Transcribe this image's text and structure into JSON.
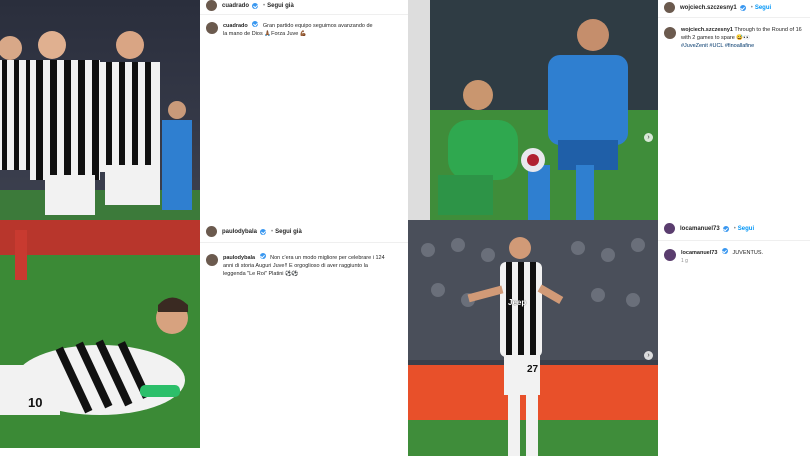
{
  "posts": [
    {
      "username": "cuadrado",
      "follow_label": "Segui già",
      "caption_user": "cuadrado",
      "caption": "Gran partido equipo seguimos avanzando de la mano de Dios 🙏🏾Forza Juve 💪🏾",
      "time": ""
    },
    {
      "username": "wojciech.szczesny1",
      "follow_label": "Segui",
      "caption_user": "wojciech.szczesny1",
      "caption": "Through to the Round of 16 with 2 games to spare 😅👀",
      "tags": "#JuveZenit #UCL #finoallafine",
      "time": ""
    },
    {
      "username": "paulodybala",
      "follow_label": "Segui già",
      "caption_user": "paulodybala",
      "caption": "Non c'era un modo migliore per celebrare i 124 anni di storia Auguri Juve!! E orgoglioso di aver raggiunto la leggenda \"Le Roi\" Platini ⚽⚽",
      "time": ""
    },
    {
      "username": "locamanuel73",
      "follow_label": "Segui",
      "caption_user": "locamanuel73",
      "caption": "JUVENTUS.",
      "time": "1 g"
    }
  ],
  "jerseys": {
    "number_10": "10",
    "number_27": "27",
    "sponsor": "Jeep"
  },
  "colors": {
    "juve_black": "#111111",
    "juve_white": "#f4f4f4",
    "zenit_blue": "#2f7fd0",
    "gk_green": "#2fa84f",
    "pitch": "#3f8d3a",
    "verified": "#3897f0",
    "link_blue": "#0095f6"
  }
}
